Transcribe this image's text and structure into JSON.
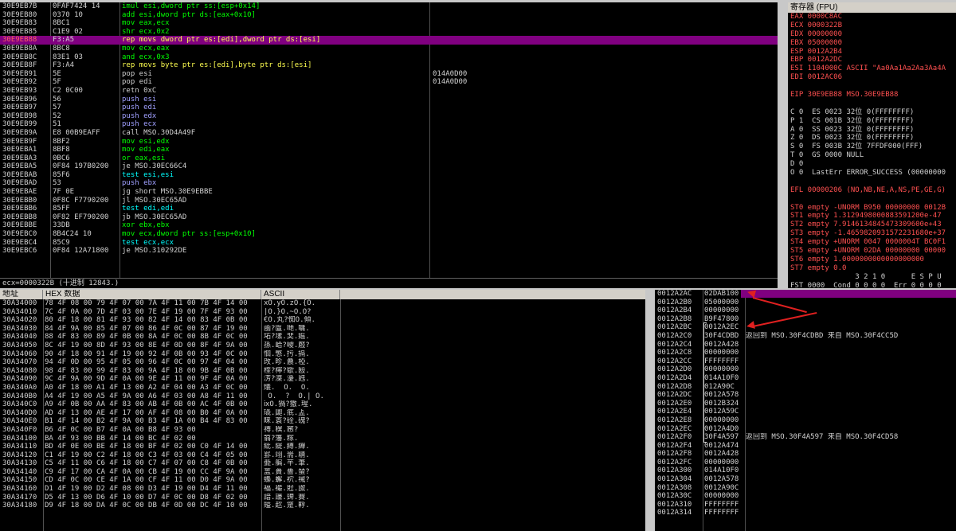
{
  "disasm": {
    "rows": [
      {
        "addr": "30E9EB7B",
        "hex": "0FAF7424 14",
        "ins": "imul esi,dword ptr ss:[esp+0x14]",
        "cmt": ""
      },
      {
        "addr": "30E9EB80",
        "hex": "0370 10",
        "ins": "add esi,dword ptr ds:[eax+0x10]",
        "cmt": ""
      },
      {
        "addr": "30E9EB83",
        "hex": "8BC1",
        "ins": "mov eax,ecx",
        "cmt": ""
      },
      {
        "addr": "30E9EB85",
        "hex": "C1E9 02",
        "ins": "shr ecx,0x2",
        "cmt": ""
      },
      {
        "addr": "30E9EB88",
        "hex": "F3:A5",
        "ins": "rep movs dword ptr es:[edi],dword ptr ds:[esi]",
        "cmt": ""
      },
      {
        "addr": "30E9EB8A",
        "hex": "8BC8",
        "ins": "mov ecx,eax",
        "cmt": ""
      },
      {
        "addr": "30E9EB8C",
        "hex": "83E1 03",
        "ins": "and ecx,0x3",
        "cmt": ""
      },
      {
        "addr": "30E9EB8F",
        "hex": "F3:A4",
        "ins": "rep movs byte ptr es:[edi],byte ptr ds:[esi]",
        "cmt": ""
      },
      {
        "addr": "30E9EB91",
        "hex": "5E",
        "ins": "pop esi",
        "cmt": "014A0D00"
      },
      {
        "addr": "30E9EB92",
        "hex": "5F",
        "ins": "pop edi",
        "cmt": "014A0D00"
      },
      {
        "addr": "30E9EB93",
        "hex": "C2 0C00",
        "ins": "retn 0xC",
        "cmt": ""
      },
      {
        "addr": "30E9EB96",
        "hex": "56",
        "ins": "push esi",
        "cmt": ""
      },
      {
        "addr": "30E9EB97",
        "hex": "57",
        "ins": "push edi",
        "cmt": ""
      },
      {
        "addr": "30E9EB98",
        "hex": "52",
        "ins": "push edx",
        "cmt": ""
      },
      {
        "addr": "30E9EB99",
        "hex": "51",
        "ins": "push ecx",
        "cmt": ""
      },
      {
        "addr": "30E9EB9A",
        "hex": "E8 00B9EAFF",
        "ins": "call MSO.30D4A49F",
        "cmt": ""
      },
      {
        "addr": "30E9EB9F",
        "hex": "8BF2",
        "ins": "mov esi,edx",
        "cmt": ""
      },
      {
        "addr": "30E9EBA1",
        "hex": "8BF8",
        "ins": "mov edi,eax",
        "cmt": ""
      },
      {
        "addr": "30E9EBA3",
        "hex": "0BC6",
        "ins": "or eax,esi",
        "cmt": ""
      },
      {
        "addr": "30E9EBA5",
        "hex": "0F84 197B0200",
        "ins": "je MSO.30EC66C4",
        "cmt": ""
      },
      {
        "addr": "30E9EBAB",
        "hex": "85F6",
        "ins": "test esi,esi",
        "cmt": ""
      },
      {
        "addr": "30E9EBAD",
        "hex": "53",
        "ins": "push ebx",
        "cmt": ""
      },
      {
        "addr": "30E9EBAE",
        "hex": "7F 0E",
        "ins": "jg short MSO.30E9EBBE",
        "cmt": ""
      },
      {
        "addr": "30E9EBB0",
        "hex": "0F8C F7790200",
        "ins": "jl MSO.30EC65AD",
        "cmt": ""
      },
      {
        "addr": "30E9EBB6",
        "hex": "85FF",
        "ins": "test edi,edi",
        "cmt": ""
      },
      {
        "addr": "30E9EBB8",
        "hex": "0F82 EF790200",
        "ins": "jb MSO.30EC65AD",
        "cmt": ""
      },
      {
        "addr": "30E9EBBE",
        "hex": "33DB",
        "ins": "xor ebx,ebx",
        "cmt": ""
      },
      {
        "addr": "30E9EBC0",
        "hex": "8B4C24 10",
        "ins": "mov ecx,dword ptr ss:[esp+0x10]",
        "cmt": ""
      },
      {
        "addr": "30E9EBC4",
        "hex": "85C9",
        "ins": "test ecx,ecx",
        "cmt": ""
      },
      {
        "addr": "30E9EBC6",
        "hex": "0F84 12A71800",
        "ins": "je MSO.310292DE",
        "cmt": ""
      }
    ],
    "status": "ecx=0000322B (十进制 12843.)"
  },
  "registers": {
    "title": "寄存器 (FPU)",
    "lines": [
      "EAX 0000C8AC",
      "ECX 0000322B",
      "EDX 00000000",
      "EBX 05000000",
      "ESP 0012A2B4",
      "EBP 0012A2DC",
      "ESI 1104000C ASCII \"Aa0Aa1Aa2Aa3Aa4A",
      "EDI 0012AC06",
      "",
      "EIP 30E9EB88 MSO.30E9EB88",
      "",
      "C 0  ES 0023 32位 0(FFFFFFFF)",
      "P 1  CS 001B 32位 0(FFFFFFFF)",
      "A 0  SS 0023 32位 0(FFFFFFFF)",
      "Z 0  DS 0023 32位 0(FFFFFFFF)",
      "S 0  FS 003B 32位 7FFDF000(FFF)",
      "T 0  GS 0000 NULL",
      "D 0",
      "O 0  LastErr ERROR_SUCCESS (00000000",
      "",
      "EFL 00000206 (NO,NB,NE,A,NS,PE,GE,G)",
      "",
      "ST0 empty -UNORM B950 00000000 0012B",
      "ST1 empty 1.3129498000883591200e-47",
      "ST2 empty 7.9146134845473309600e+43",
      "ST3 empty -1.4659820931572231680e+37",
      "ST4 empty +UNORM 0047 0000004T BC0F1",
      "ST5 empty +UNORM 02DA 00000000 00000",
      "ST6 empty 1.0000000000000000000",
      "ST7 empty 0.0",
      "               3 2 1 0      E S P U",
      "FST 0000  Cond 0 0 0 0  Err 0 0 0 0"
    ]
  },
  "dump": {
    "headers": {
      "addr": "地址",
      "hex": "HEX 数据",
      "ascii": "ASCII"
    },
    "rows": [
      {
        "addr": "30A34000",
        "hex": "78 4F 08 00 79 4F 07 00 7A 4F 11 00 7B 4F 14 00",
        "ascii": "xO.yO.zO.{O."
      },
      {
        "addr": "30A34010",
        "hex": "7C 4F 0A 00 7D 4F 03 00 7E 4F 19 00 7F 4F 93 00",
        "ascii": "|O.}O.~O.O?"
      },
      {
        "addr": "30A34020",
        "hex": "80 4F 18 00 81 4F 93 00 82 4F 14 00 83 4F 0B 00",
        "ascii": "€O.丸?倁O.傾."
      },
      {
        "addr": "30A34030",
        "hex": "84 4F 9A 00 85 4F 07 00 86 4F 0C 00 87 4F 19 00",
        "ascii": "凾?匫.哋.嘃."
      },
      {
        "addr": "30A34040",
        "hex": "88 4F 83 00 89 4F 0B 00 8A 4F 0C 00 8B 4F 0C 00",
        "ascii": "坧?塐.奜.媱."
      },
      {
        "addr": "30A34050",
        "hex": "8C 4F 19 00 8D 4F 93 00 8E 4F 0D 00 8F 4F 9A 00",
        "ascii": "孫.峆?巎.廏?"
      },
      {
        "addr": "30A34060",
        "hex": "90 4F 18 00 91 4F 19 00 92 4F 0B 00 93 4F 0C 00",
        "ascii": "恛.慜.扝.搹."
      },
      {
        "addr": "30A34070",
        "hex": "94 4F 0D 00 95 4F 05 00 96 4F 0C 00 97 4F 04 00",
        "ascii": "攺.昣.曟.椏."
      },
      {
        "addr": "30A34080",
        "hex": "98 4F 83 00 99 4F 83 00 9A 4F 18 00 9B 4F 0B 00",
        "ascii": "楏?檸?歜.殹."
      },
      {
        "addr": "30A34090",
        "hex": "9C 4F 9A 00 9D 4F 0A 00 9E 4F 11 00 9F 4F 0A 00",
        "ascii": "淓?滐.瀀.瓲."
      },
      {
        "addr": "30A340A0",
        "hex": "A0 4F 18 00 A1 4F 13 00 A2 4F 04 00 A3 4F 0C 00",
        "ascii": "燨.  O.  O. "
      },
      {
        "addr": "30A340B0",
        "hex": "A4 4F 19 00 A5 4F 9A 00 A6 4F 03 00 A8 4F 11 00",
        "ascii": " O.  ?  O.| O."
      },
      {
        "addr": "30A340C0",
        "hex": "A9 4F 0B 00 AA 4F 83 00 AB 4F 0B 00 AC 4F 0B 00",
        "ascii": "ⅸO.猧?獥.瑆."
      },
      {
        "addr": "30A340D0",
        "hex": "AD 4F 13 00 AE 4F 17 00 AF 4F 08 00 B0 4F 0A 00",
        "ascii": "璏.瓟.疧.盀."
      },
      {
        "addr": "30A340E0",
        "hex": "B1 4F 14 00 B2 4F 9A 00 B3 4F 1A 00 B4 4F 83 00",
        "ascii": "睐.瞏?硂.磈?"
      },
      {
        "addr": "30A340F0",
        "hex": "B6 4F 0C 00 B7 4F 0A 00 B8 4F 93 00",
        "ascii": "禣.穓.窸?"
      },
      {
        "addr": "30A34100",
        "hex": "BA 4F 93 00 BB 4F 14 00 BC 4F 02 00",
        "ascii": "篛?籓.糘."
      },
      {
        "addr": "30A34110",
        "hex": "BD 4F 0E 00 BE 4F 18 00 BF 4F 02 00 C0 4F 14 00",
        "ascii": "紕.緹.縛.繟."
      },
      {
        "addr": "30A34120",
        "hex": "C1 4F 19 00 C2 4F 18 00 C3 4F 03 00 C4 4F 05 00",
        "ascii": "罫.翊.耑.聙."
      },
      {
        "addr": "30A34130",
        "hex": "C5 4F 11 00 C6 4F 18 00 C7 4F 07 00 C8 4F 0B 00",
        "ascii": "臦.艑.芉.茟."
      },
      {
        "addr": "30A34140",
        "hex": "C9 4F 17 00 CA 4F 0A 00 CB 4F 19 00 CC 4F 9A 00",
        "ascii": "蒕.蕢.薔.蝅?"
      },
      {
        "addr": "30A34150",
        "hex": "CD 4F 0C 00 CE 4F 1A 00 CF 4F 11 00 D0 4F 9A 00",
        "ascii": "蟂.蠏.袕.裓?"
      },
      {
        "addr": "30A34160",
        "hex": "D1 4F 19 00 D2 4F 08 00 D3 4F 19 00 D4 4F 11 00",
        "ascii": "褔.襊.覎.詉."
      },
      {
        "addr": "30A34170",
        "hex": "D5 4F 13 00 D6 4F 10 00 D7 4F 0C 00 D8 4F 02 00",
        "ascii": "諳.譹.豍.賽."
      },
      {
        "addr": "30A34180",
        "hex": "D9 4F 18 00 DA 4F 0C 00 DB 4F 0D 00 DC 4F 10 00",
        "ascii": "賹.赼.跾.軤."
      }
    ]
  },
  "stack": {
    "rows": [
      {
        "addr": "0012A2AC",
        "val": "02DAB100",
        "cmt": ""
      },
      {
        "addr": "0012A2B0",
        "val": "05000000",
        "cmt": ""
      },
      {
        "addr": "0012A2B4",
        "val": "00000000",
        "cmt": ""
      },
      {
        "addr": "0012A2B8",
        "val": "B9F47800",
        "cmt": ""
      },
      {
        "addr": "0012A2BC",
        "val": "0012A2EC",
        "cmt": ""
      },
      {
        "addr": "0012A2C0",
        "val": "30F4CDBD",
        "cmt": "返回到 MSO.30F4CDBD 来自 MSO.30F4CC5D"
      },
      {
        "addr": "0012A2C4",
        "val": "0012A428",
        "cmt": ""
      },
      {
        "addr": "0012A2C8",
        "val": "00000000",
        "cmt": ""
      },
      {
        "addr": "0012A2CC",
        "val": "FFFFFFFF",
        "cmt": ""
      },
      {
        "addr": "0012A2D0",
        "val": "00000000",
        "cmt": ""
      },
      {
        "addr": "0012A2D4",
        "val": "014A10F0",
        "cmt": ""
      },
      {
        "addr": "0012A2D8",
        "val": "012A90C",
        "cmt": ""
      },
      {
        "addr": "0012A2DC",
        "val": "0012A578",
        "cmt": ""
      },
      {
        "addr": "0012A2E0",
        "val": "0012B324",
        "cmt": ""
      },
      {
        "addr": "0012A2E4",
        "val": "0012A59C",
        "cmt": ""
      },
      {
        "addr": "0012A2E8",
        "val": "00000000",
        "cmt": ""
      },
      {
        "addr": "0012A2EC",
        "val": "0012A4D0",
        "cmt": ""
      },
      {
        "addr": "0012A2F0",
        "val": "30F4A597",
        "cmt": "返回到 MSO.30F4A597 来自 MSO.30F4CD58"
      },
      {
        "addr": "0012A2F4",
        "val": "0012A474",
        "cmt": ""
      },
      {
        "addr": "0012A2F8",
        "val": "0012A428",
        "cmt": ""
      },
      {
        "addr": "0012A2FC",
        "val": "00000000",
        "cmt": ""
      },
      {
        "addr": "0012A300",
        "val": "014A10F0",
        "cmt": ""
      },
      {
        "addr": "0012A304",
        "val": "0012A578",
        "cmt": ""
      },
      {
        "addr": "0012A308",
        "val": "0012A90C",
        "cmt": ""
      },
      {
        "addr": "0012A30C",
        "val": "00000000",
        "cmt": ""
      },
      {
        "addr": "0012A310",
        "val": "FFFFFFFF",
        "cmt": ""
      },
      {
        "addr": "0012A314",
        "val": "FFFFFFFF",
        "cmt": ""
      }
    ]
  },
  "colors": {
    "selection": "#800080",
    "annotation": "#e02020"
  }
}
